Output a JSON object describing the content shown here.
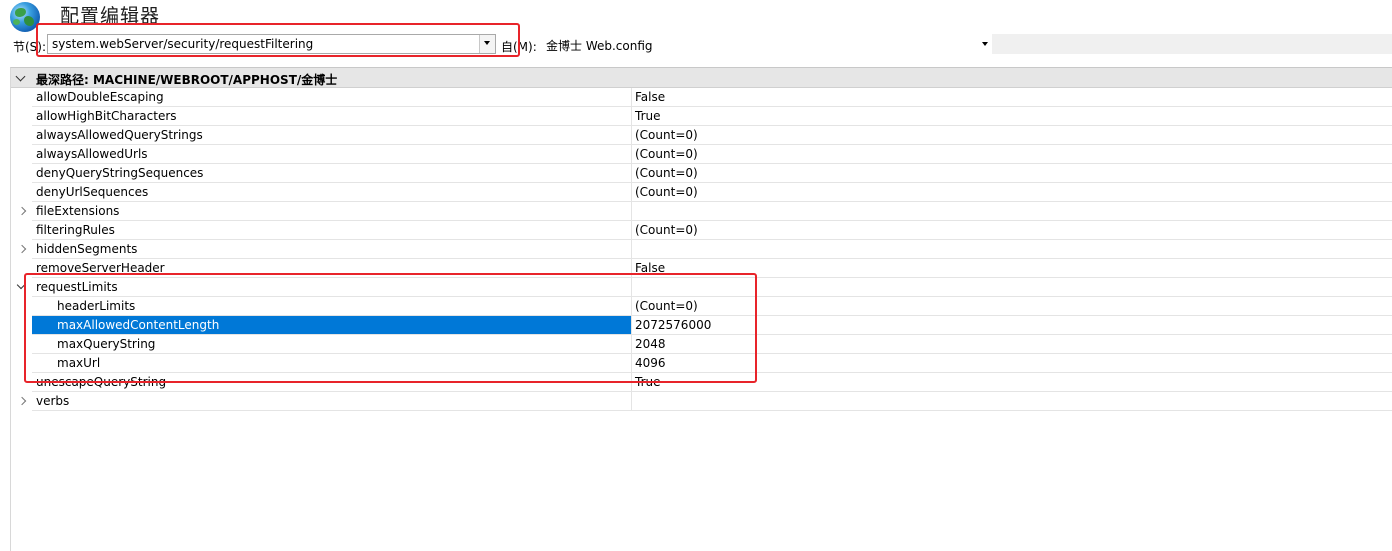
{
  "header": {
    "title": "配置编辑器",
    "section_label": "节(S):",
    "section_value": "system.webServer/security/requestFiltering",
    "from_label": "自(M):",
    "from_value": "金博士 Web.config"
  },
  "grid": {
    "group_header": "最深路径: MACHINE/WEBROOT/APPHOST/金博士",
    "rows": [
      {
        "name": "allowDoubleEscaping",
        "value": "False"
      },
      {
        "name": "allowHighBitCharacters",
        "value": "True"
      },
      {
        "name": "alwaysAllowedQueryStrings",
        "value": "(Count=0)"
      },
      {
        "name": "alwaysAllowedUrls",
        "value": "(Count=0)"
      },
      {
        "name": "denyQueryStringSequences",
        "value": "(Count=0)"
      },
      {
        "name": "denyUrlSequences",
        "value": "(Count=0)"
      },
      {
        "name": "fileExtensions",
        "value": ""
      },
      {
        "name": "filteringRules",
        "value": "(Count=0)"
      },
      {
        "name": "hiddenSegments",
        "value": ""
      },
      {
        "name": "removeServerHeader",
        "value": "False"
      },
      {
        "name": "requestLimits",
        "value": ""
      },
      {
        "name": "headerLimits",
        "value": "(Count=0)"
      },
      {
        "name": "maxAllowedContentLength",
        "value": "2072576000"
      },
      {
        "name": "maxQueryString",
        "value": "2048"
      },
      {
        "name": "maxUrl",
        "value": "4096"
      },
      {
        "name": "unescapeQueryString",
        "value": "True"
      },
      {
        "name": "verbs",
        "value": ""
      }
    ]
  },
  "colors": {
    "selection": "#0078d7",
    "highlight_box": "#e8242a"
  },
  "icons": {
    "app_icon": "globe-icon",
    "expand_collapsed": "chevron-right-icon",
    "expand_open": "chevron-down-icon",
    "dropdown": "dropdown-arrow-icon"
  }
}
